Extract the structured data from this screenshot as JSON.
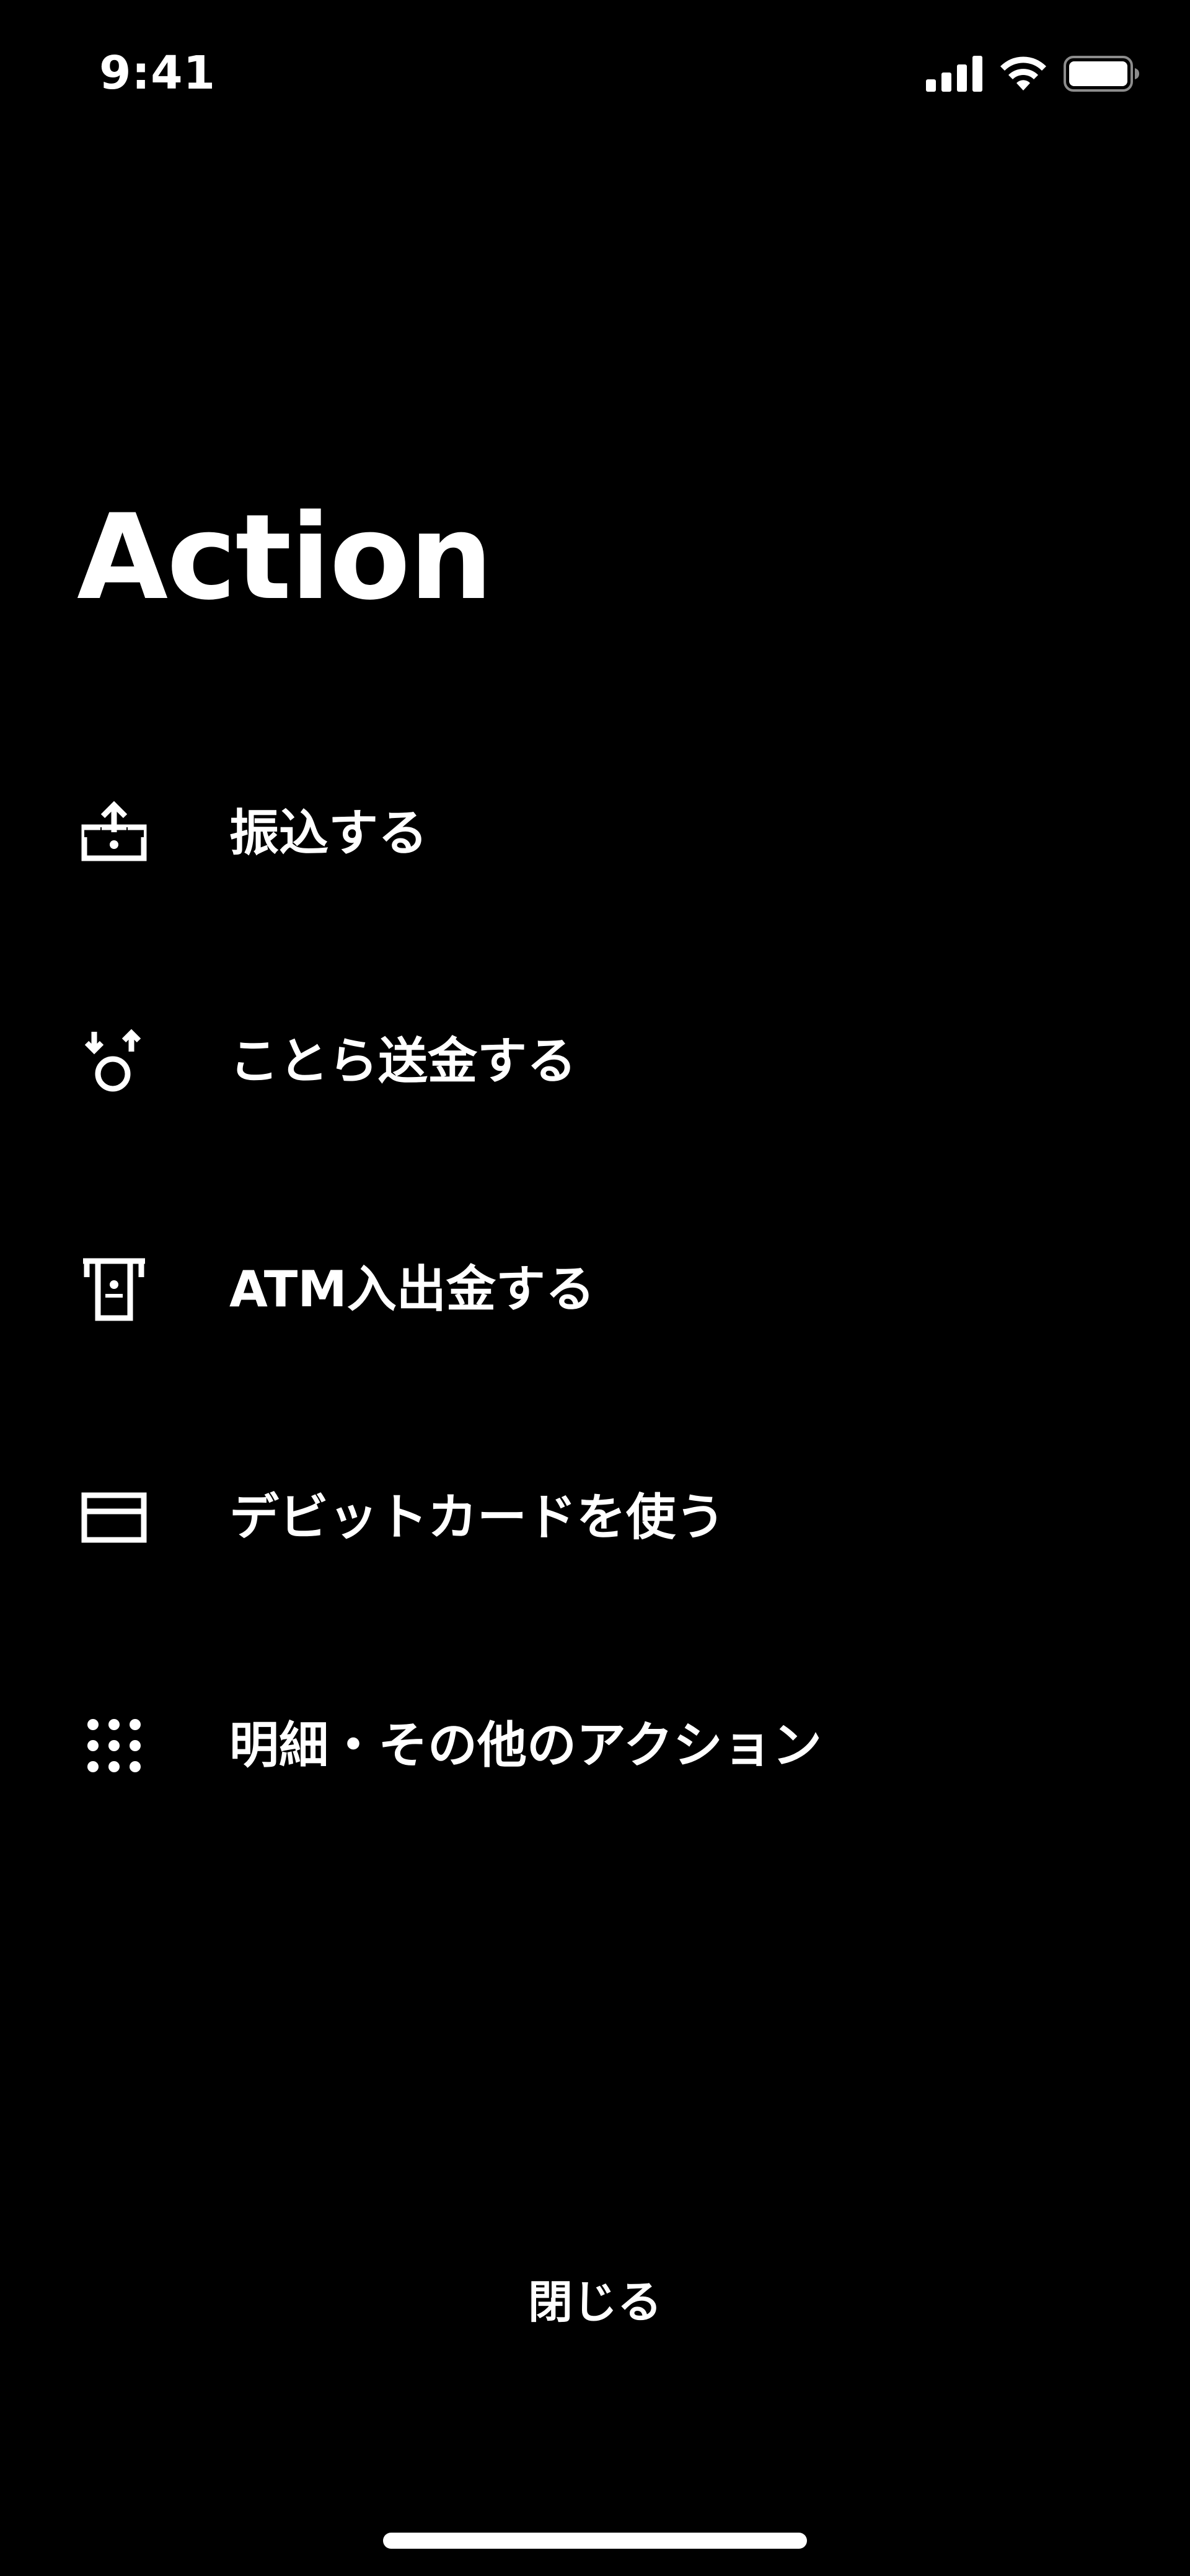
{
  "status_bar": {
    "time": "9:41",
    "icons": [
      "cellular-signal-icon",
      "wifi-icon",
      "battery-icon"
    ]
  },
  "page": {
    "title": "Action"
  },
  "menu": {
    "items": [
      {
        "label": "振込する",
        "icon": "bank-transfer-icon"
      },
      {
        "label": "ことら送金する",
        "icon": "kotora-transfer-icon"
      },
      {
        "label": "ATM入出金する",
        "icon": "atm-icon"
      },
      {
        "label": "デビットカードを使う",
        "icon": "debit-card-icon"
      },
      {
        "label": "明細・その他のアクション",
        "icon": "more-grid-icon"
      }
    ]
  },
  "footer": {
    "close_label": "閉じる"
  },
  "colors": {
    "background": "#000000",
    "foreground": "#ffffff"
  }
}
